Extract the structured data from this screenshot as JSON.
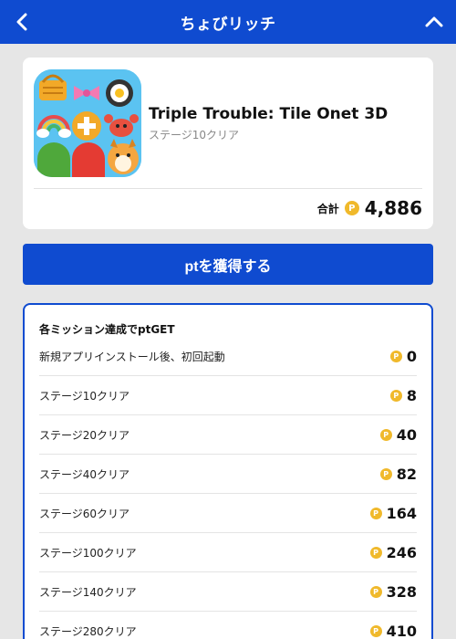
{
  "header": {
    "title": "ちょびリッチ",
    "back_icon": "chevron-left-icon",
    "collapse_icon": "chevron-up-icon"
  },
  "app": {
    "name": "Triple Trouble: Tile Onet 3D",
    "status": "ステージ10クリア",
    "total_label": "合計",
    "total_value": "4,886",
    "coin_symbol": "P"
  },
  "action": {
    "label": "ptを獲得する"
  },
  "missions": {
    "title": "各ミッション達成でptGET",
    "items": [
      {
        "label": "新規アプリインストール後、初回起動",
        "points": "0"
      },
      {
        "label": "ステージ10クリア",
        "points": "8"
      },
      {
        "label": "ステージ20クリア",
        "points": "40"
      },
      {
        "label": "ステージ40クリア",
        "points": "82"
      },
      {
        "label": "ステージ60クリア",
        "points": "164"
      },
      {
        "label": "ステージ100クリア",
        "points": "246"
      },
      {
        "label": "ステージ140クリア",
        "points": "328"
      },
      {
        "label": "ステージ280クリア",
        "points": "410"
      }
    ]
  },
  "colors": {
    "brand_blue": "#0f4bd0",
    "coin_gold": "#f0b92b",
    "background": "#e6e6e6"
  }
}
